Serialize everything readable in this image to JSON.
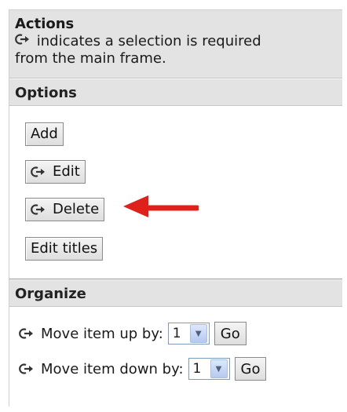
{
  "header": {
    "title": "Actions",
    "desc_line1": "indicates a selection is required",
    "desc_line2": "from the main frame."
  },
  "options": {
    "heading": "Options",
    "add_label": "Add",
    "edit_label": "Edit",
    "delete_label": "Delete",
    "edit_titles_label": "Edit titles"
  },
  "organize": {
    "heading": "Organize",
    "move_up_label": "Move item up by:",
    "move_up_value": "1",
    "move_down_label": "Move item down by:",
    "move_down_value": "1",
    "go_label": "Go"
  },
  "annotation": {
    "arrow_color": "#e0201b",
    "points_to": "delete-button"
  },
  "icons": {
    "selection_required": "selection-required-icon",
    "dropdown": "chevron-down-icon"
  }
}
